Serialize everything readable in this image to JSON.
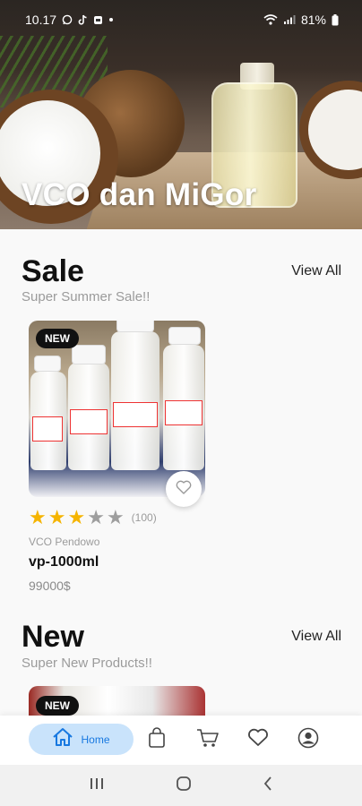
{
  "status_bar": {
    "time": "10.17",
    "battery": "81%",
    "icons": [
      "whatsapp-icon",
      "tiktok-icon",
      "gallery-icon",
      "dot-icon",
      "wifi-icon",
      "signal-icon",
      "battery-icon"
    ]
  },
  "hero": {
    "title": "VCO dan MiGor"
  },
  "sections": [
    {
      "title": "Sale",
      "subtitle": "Super Summer Sale!!",
      "view_all": "View All",
      "products": [
        {
          "badge": "NEW",
          "rating": 3,
          "rating_max": 5,
          "rating_count": "(100)",
          "brand": "VCO Pendowo",
          "name": "vp-1000ml",
          "price": "99000$"
        }
      ]
    },
    {
      "title": "New",
      "subtitle": "Super New Products!!",
      "view_all": "View All",
      "products": [
        {
          "badge": "NEW"
        }
      ]
    }
  ],
  "bottom_nav": {
    "items": [
      {
        "label": "Home",
        "icon": "home-icon",
        "active": true
      },
      {
        "label": "",
        "icon": "shopping-bag-icon",
        "active": false
      },
      {
        "label": "",
        "icon": "cart-icon",
        "active": false
      },
      {
        "label": "",
        "icon": "heart-icon",
        "active": false
      },
      {
        "label": "",
        "icon": "profile-icon",
        "active": false
      }
    ]
  },
  "colors": {
    "accent": "#1778e0",
    "active_pill": "#c9e3fb",
    "star_on": "#f5b400",
    "star_off": "#9e9e9e",
    "badge_bg": "#111111"
  }
}
